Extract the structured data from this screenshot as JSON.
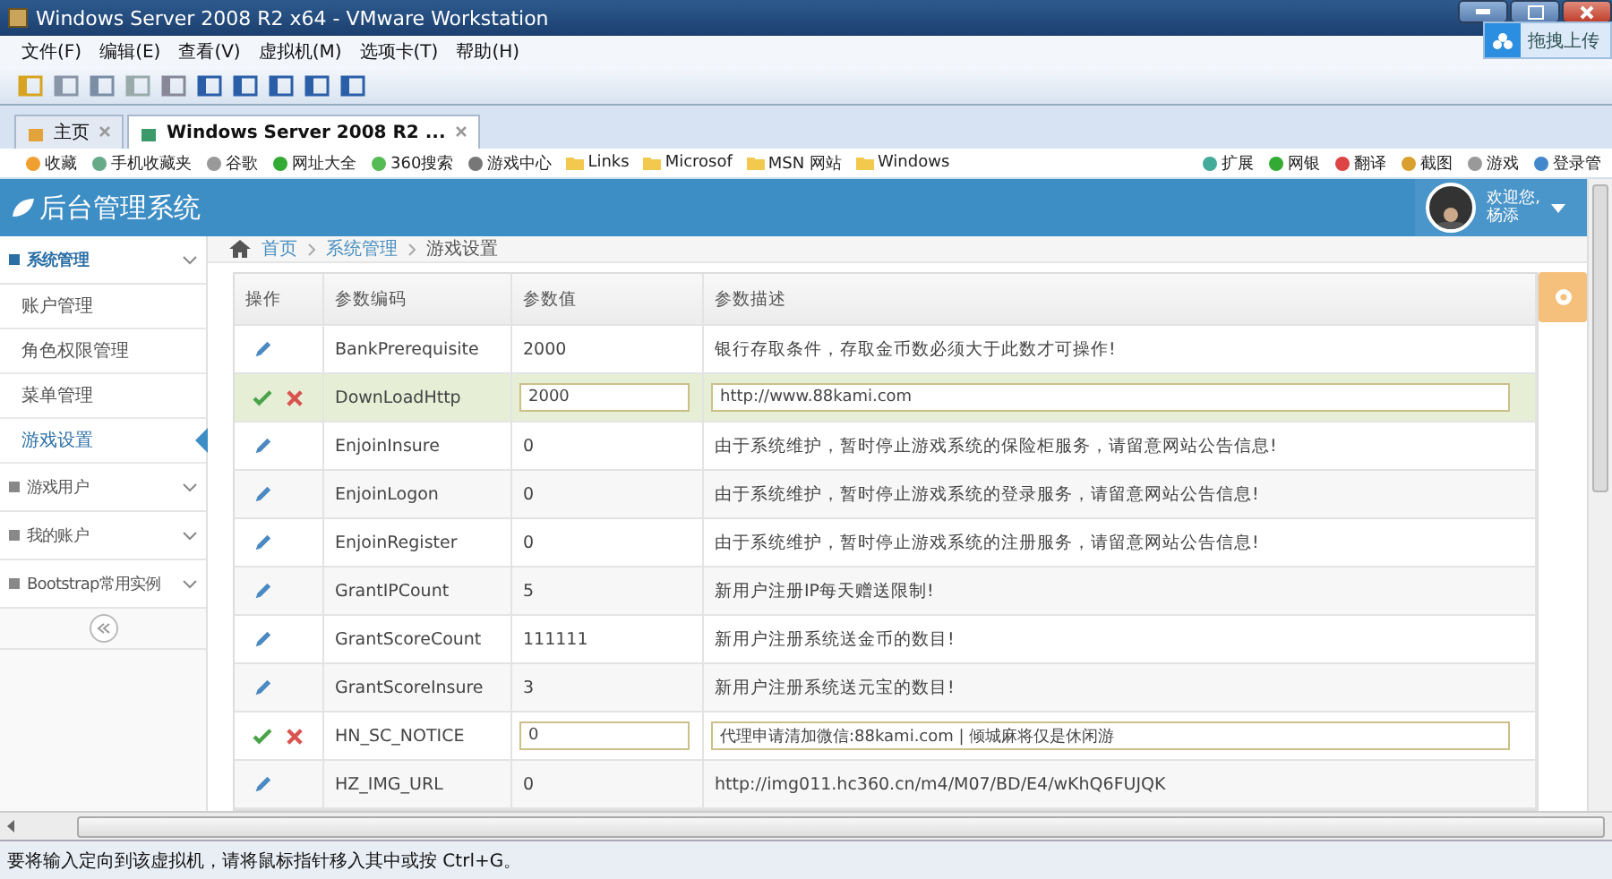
{
  "window": {
    "title": "Windows Server 2008 R2 x64 - VMware Workstation"
  },
  "upload_widget": {
    "label": "拖拽上传"
  },
  "menu": [
    "文件(F)",
    "编辑(E)",
    "查看(V)",
    "虚拟机(M)",
    "选项卡(T)",
    "帮助(H)"
  ],
  "tabs": [
    {
      "label": "主页",
      "selected": false
    },
    {
      "label": "Windows Server 2008 R2 ...",
      "selected": true
    }
  ],
  "favorites": {
    "left": [
      "收藏",
      "手机收藏夹",
      "谷歌",
      "网址大全",
      "360搜索",
      "游戏中心",
      "Links",
      "Microsof",
      "MSN 网站",
      "Windows"
    ],
    "right": [
      "扩展",
      "网银",
      "翻译",
      "截图",
      "游戏",
      "登录管"
    ]
  },
  "app": {
    "logo": "后台管理系统",
    "user": {
      "greeting": "欢迎您,",
      "name": "杨添"
    }
  },
  "sidebar": [
    {
      "label": "系统管理",
      "expanded": true,
      "children": [
        {
          "label": "账户管理",
          "selected": false
        },
        {
          "label": "角色权限管理",
          "selected": false
        },
        {
          "label": "菜单管理",
          "selected": false
        },
        {
          "label": "游戏设置",
          "selected": true
        }
      ]
    },
    {
      "label": "游戏用户",
      "expanded": false
    },
    {
      "label": "我的账户",
      "expanded": false
    },
    {
      "label": "Bootstrap常用实例",
      "expanded": false
    }
  ],
  "breadcrumb": [
    "首页",
    "系统管理",
    "游戏设置"
  ],
  "table": {
    "columns": [
      "操作",
      "参数编码",
      "参数值",
      "参数描述"
    ],
    "rows": [
      {
        "kind": "view",
        "highlighted": false,
        "code": "BankPrerequisite",
        "value": "2000",
        "description": "银行存取条件，存取金币数必须大于此数才可操作!"
      },
      {
        "kind": "edit",
        "highlighted": true,
        "code": "DownLoadHttp",
        "value": "2000",
        "description": "http://www.88kami.com"
      },
      {
        "kind": "view",
        "highlighted": false,
        "code": "EnjoinInsure",
        "value": "0",
        "description": "由于系统维护，暂时停止游戏系统的保险柜服务，请留意网站公告信息!"
      },
      {
        "kind": "view",
        "highlighted": false,
        "code": "EnjoinLogon",
        "value": "0",
        "description": "由于系统维护，暂时停止游戏系统的登录服务，请留意网站公告信息!"
      },
      {
        "kind": "view",
        "highlighted": false,
        "code": "EnjoinRegister",
        "value": "0",
        "description": "由于系统维护，暂时停止游戏系统的注册服务，请留意网站公告信息!"
      },
      {
        "kind": "view",
        "highlighted": false,
        "code": "GrantIPCount",
        "value": "5",
        "description": "新用户注册IP每天赠送限制!"
      },
      {
        "kind": "view",
        "highlighted": false,
        "code": "GrantScoreCount",
        "value": "111111",
        "description": "新用户注册系统送金币的数目!"
      },
      {
        "kind": "view",
        "highlighted": false,
        "code": "GrantScoreInsure",
        "value": "3",
        "description": "新用户注册系统送元宝的数目!"
      },
      {
        "kind": "edit",
        "highlighted": false,
        "code": "HN_SC_NOTICE",
        "value": "0",
        "description": "代理申请清加微信:88kami.com | 倾城麻将仅是休闲游"
      },
      {
        "kind": "view",
        "highlighted": false,
        "code": "HZ_IMG_URL",
        "value": "0",
        "description": "http://img011.hc360.cn/m4/M07/BD/E4/wKhQ6FUJQK"
      }
    ]
  },
  "status_bar": "要将输入定向到该虚拟机，请将鼠标指针移入其中或按 Ctrl+G。"
}
